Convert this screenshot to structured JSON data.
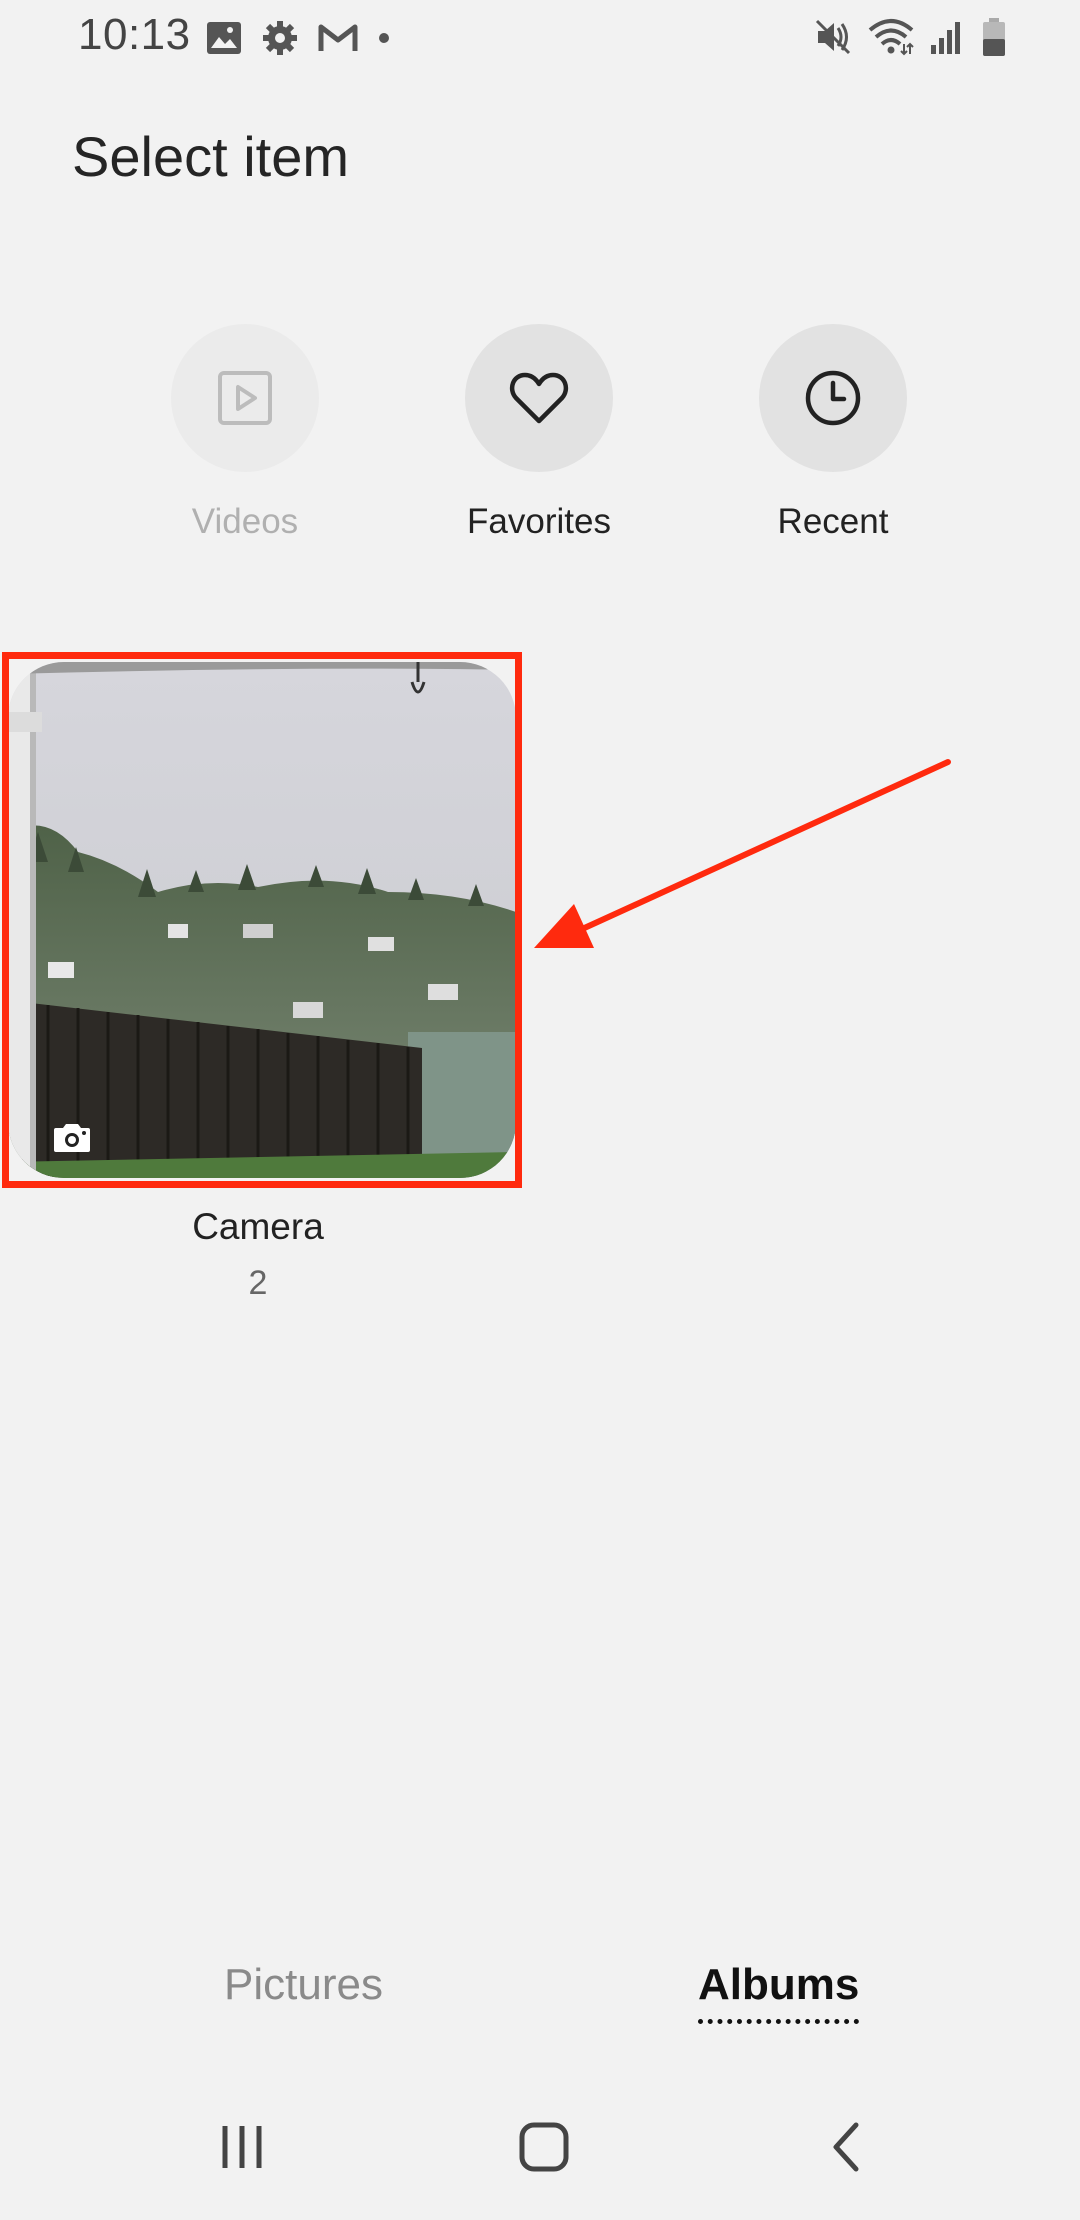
{
  "status_bar": {
    "time": "10:13"
  },
  "header": {
    "title": "Select item"
  },
  "shortcuts": [
    {
      "label": "Videos",
      "icon": "video-icon",
      "enabled": false
    },
    {
      "label": "Favorites",
      "icon": "heart-icon",
      "enabled": true
    },
    {
      "label": "Recent",
      "icon": "clock-icon",
      "enabled": true
    }
  ],
  "albums": [
    {
      "name": "Camera",
      "count": "2",
      "icon": "camera-icon"
    }
  ],
  "tabs": [
    {
      "label": "Pictures",
      "selected": false
    },
    {
      "label": "Albums",
      "selected": true
    }
  ],
  "annotation": {
    "color": "#ff2a0e"
  },
  "nav": {
    "recents": "recents-icon",
    "home": "home-icon",
    "back": "back-icon"
  }
}
